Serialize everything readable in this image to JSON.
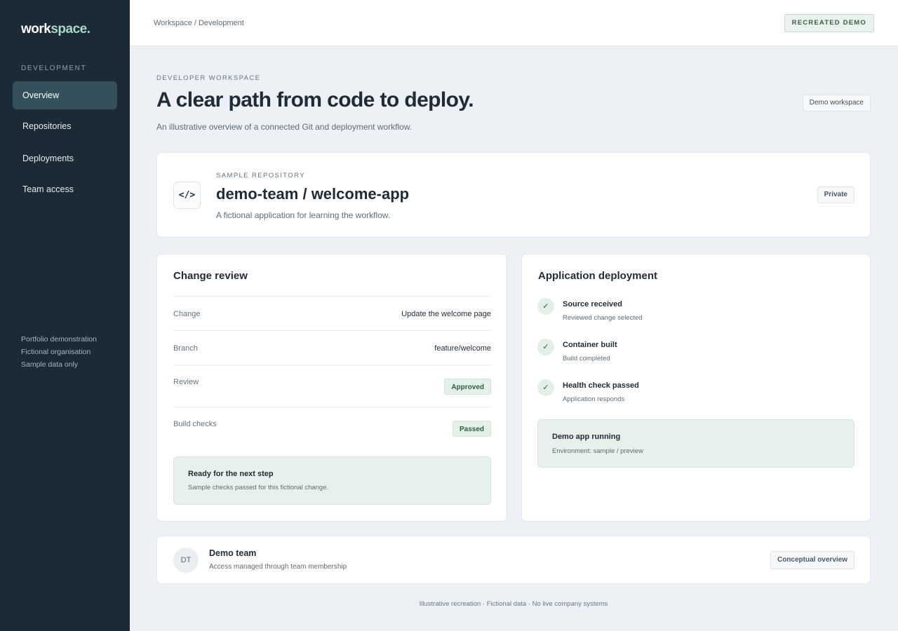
{
  "sidebar": {
    "logo_main": "work",
    "logo_accent": "space.",
    "heading": "DEVELOPMENT",
    "items": [
      {
        "label": "Overview"
      },
      {
        "label": "Repositories"
      },
      {
        "label": "Deployments"
      },
      {
        "label": "Team access"
      }
    ],
    "notes": [
      "Portfolio demonstration",
      "Fictional organisation",
      "Sample data only"
    ]
  },
  "topbar": {
    "breadcrumb": "Workspace / Development",
    "badge": "RECREATED DEMO"
  },
  "hero": {
    "eyebrow": "DEVELOPER WORKSPACE",
    "title": "A clear path from code to deploy.",
    "subtitle": "An illustrative overview of a connected Git and deployment workflow.",
    "chip": "Demo workspace"
  },
  "repo": {
    "icon_glyph": "</>",
    "eyebrow": "SAMPLE REPOSITORY",
    "title": "demo-team / welcome-app",
    "description": "A fictional application for learning the workflow.",
    "visibility": "Private"
  },
  "review": {
    "title": "Change review",
    "rows": [
      {
        "label": "Change",
        "value": "Update the welcome page"
      },
      {
        "label": "Branch",
        "value": "feature/welcome"
      },
      {
        "label": "Review",
        "status": "Approved"
      },
      {
        "label": "Build checks",
        "status": "Passed"
      }
    ],
    "note_title": "Ready for the next step",
    "note_sub": "Sample checks passed for this fictional change."
  },
  "deploy": {
    "title": "Application deployment",
    "check_glyph": "✓",
    "steps": [
      {
        "title": "Source received",
        "sub": "Reviewed change selected"
      },
      {
        "title": "Container built",
        "sub": "Build completed"
      },
      {
        "title": "Health check passed",
        "sub": "Application responds"
      }
    ],
    "note_title": "Demo app running",
    "note_sub": "Environment: sample / preview"
  },
  "team": {
    "initials": "DT",
    "name": "Demo team",
    "sub": "Access managed through team membership",
    "chip": "Conceptual overview"
  },
  "footer": "Illustrative recreation · Fictional data · No live company systems"
}
